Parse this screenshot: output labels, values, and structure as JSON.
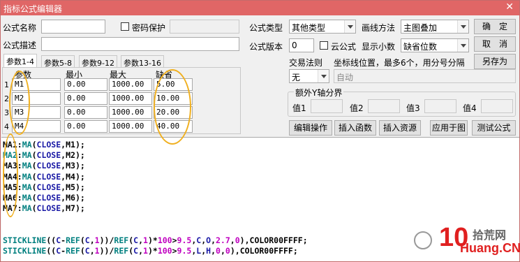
{
  "window": {
    "title": "指标公式编辑器",
    "close_glyph": "✕"
  },
  "form": {
    "name_label": "公式名称",
    "name_value": "",
    "password_label": "密码保护",
    "desc_label": "公式描述",
    "desc_value": "",
    "type_label": "公式类型",
    "type_value": "其他类型",
    "draw_label": "画线方法",
    "draw_value": "主图叠加",
    "version_label": "公式版本",
    "version_value": "0",
    "cloud_label": "云公式",
    "decimals_label": "显示小数",
    "decimals_value": "缺省位数",
    "trade_label": "交易法则",
    "trade_value": "无",
    "coord_label": "坐标线位置，最多6个，用分号分隔",
    "coord_value": "自动",
    "extra_axis_label": "额外Y轴分界",
    "extra_vals": [
      "值1",
      "值2",
      "值3",
      "值4"
    ]
  },
  "buttons": {
    "ok": "确　定",
    "cancel": "取　消",
    "save_as": "另存为",
    "edit_ops": "编辑操作",
    "insert_func": "插入函数",
    "insert_res": "插入资源",
    "apply": "应用于图",
    "test": "测试公式"
  },
  "param_tabs": [
    "参数1-4",
    "参数5-8",
    "参数9-12",
    "参数13-16"
  ],
  "param_headers": [
    "参数",
    "最小",
    "最大",
    "缺省"
  ],
  "params": [
    {
      "no": "1",
      "name": "M1",
      "min": "0.00",
      "max": "1000.00",
      "default": "5.00"
    },
    {
      "no": "2",
      "name": "M2",
      "min": "0.00",
      "max": "1000.00",
      "default": "10.00"
    },
    {
      "no": "3",
      "name": "M3",
      "min": "0.00",
      "max": "1000.00",
      "default": "20.00"
    },
    {
      "no": "4",
      "name": "M4",
      "min": "0.00",
      "max": "1000.00",
      "default": "40.00"
    }
  ],
  "code_lines": [
    "MA1:MA(CLOSE,M1);",
    "MA2:MA(CLOSE,M2);",
    "MA3:MA(CLOSE,M3);",
    "MA4:MA(CLOSE,M4);",
    "MA5:MA(CLOSE,M5);",
    "MA6:MA(CLOSE,M6);",
    "MA7:MA(CLOSE,M7);",
    "",
    "",
    "STICKLINE((C-REF(C,1))/REF(C,1)*100>9.5,C,O,2.7,0),COLOR00FFFF;",
    "STICKLINE((C-REF(C,1))/REF(C,1)*100>9.5,L,H,0,0),COLOR00FFFF;"
  ],
  "watermark": {
    "big": "10",
    "text1": "拾荒网",
    "text2": "Huang.CN"
  },
  "colors": {
    "titlebar": "#e06666",
    "highlight": "#f0b020"
  }
}
